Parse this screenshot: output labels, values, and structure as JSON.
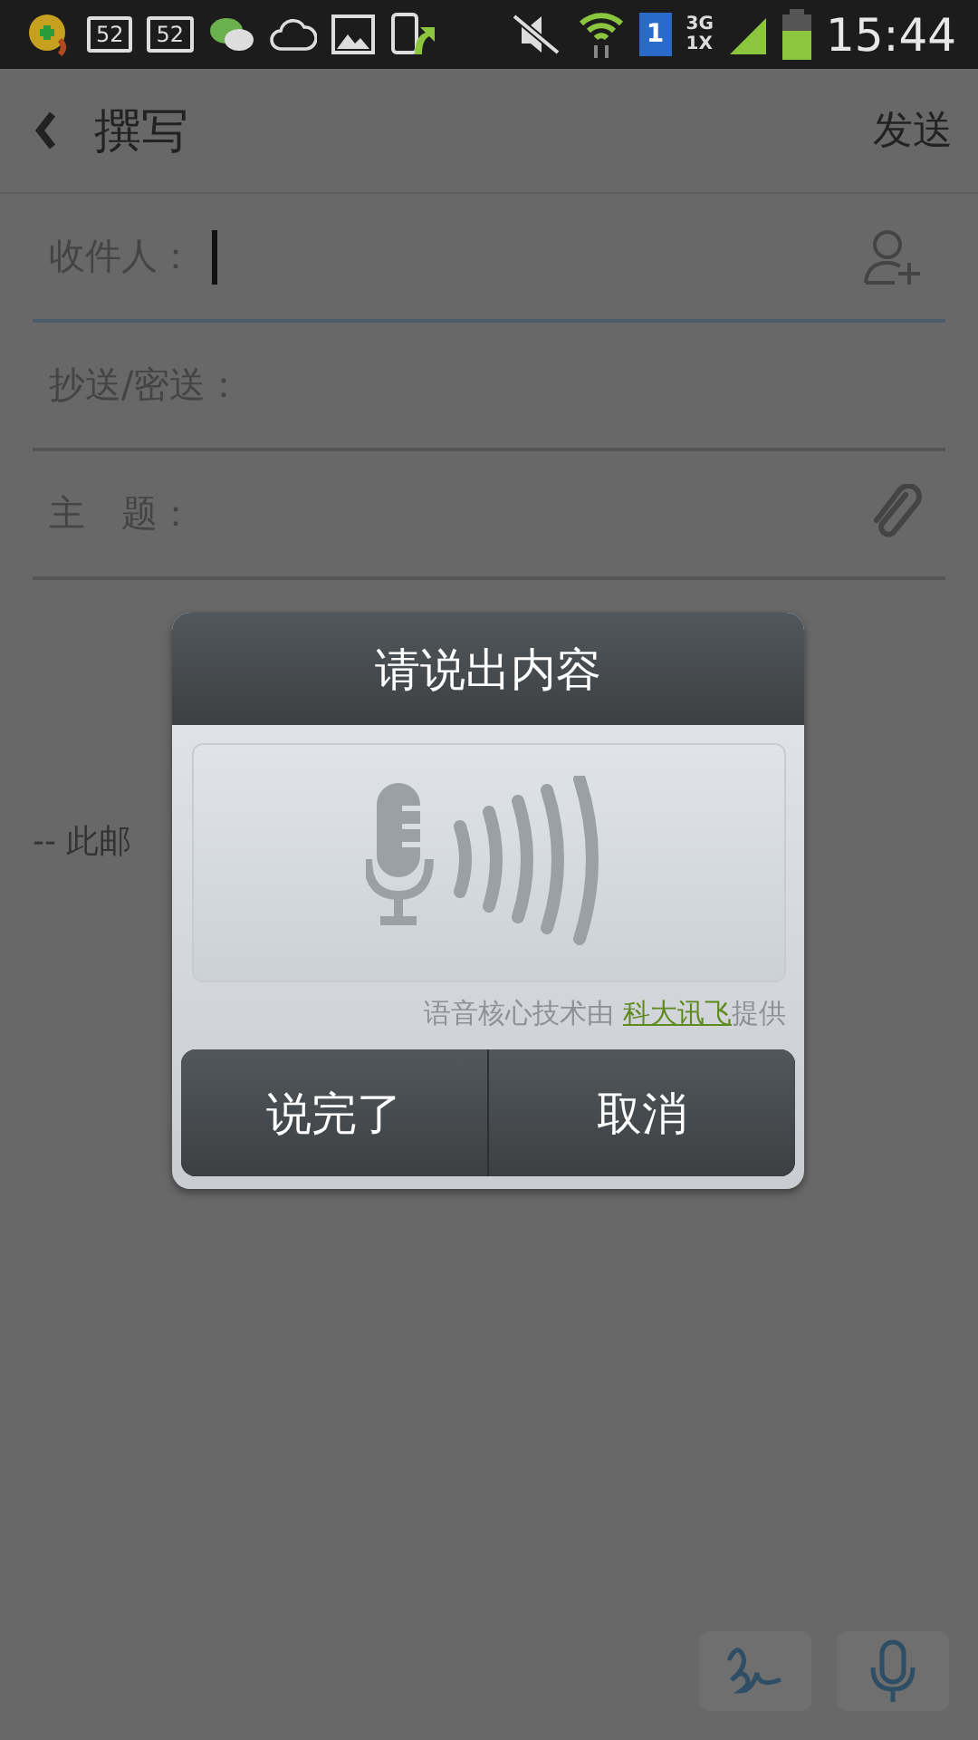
{
  "status_bar": {
    "badges": [
      "52",
      "52"
    ],
    "sim": "1",
    "network": [
      "3G",
      "1X"
    ],
    "time": "15:44"
  },
  "header": {
    "title": "撰写",
    "action": "发送"
  },
  "fields": [
    {
      "kind": "recipient",
      "label": "收件人：",
      "focused": true
    },
    {
      "kind": "plain",
      "label": "抄送/密送：",
      "focused": false
    },
    {
      "kind": "attachment",
      "label": "主　题：",
      "focused": false
    }
  ],
  "body": {
    "signature": "-- 此邮"
  },
  "dialog": {
    "title": "请说出内容",
    "credit": "语音核心技术由 ",
    "credit_link": "科大讯飞",
    "credit_suffix": "提供",
    "buttons": [
      "说完了",
      "取消"
    ]
  }
}
